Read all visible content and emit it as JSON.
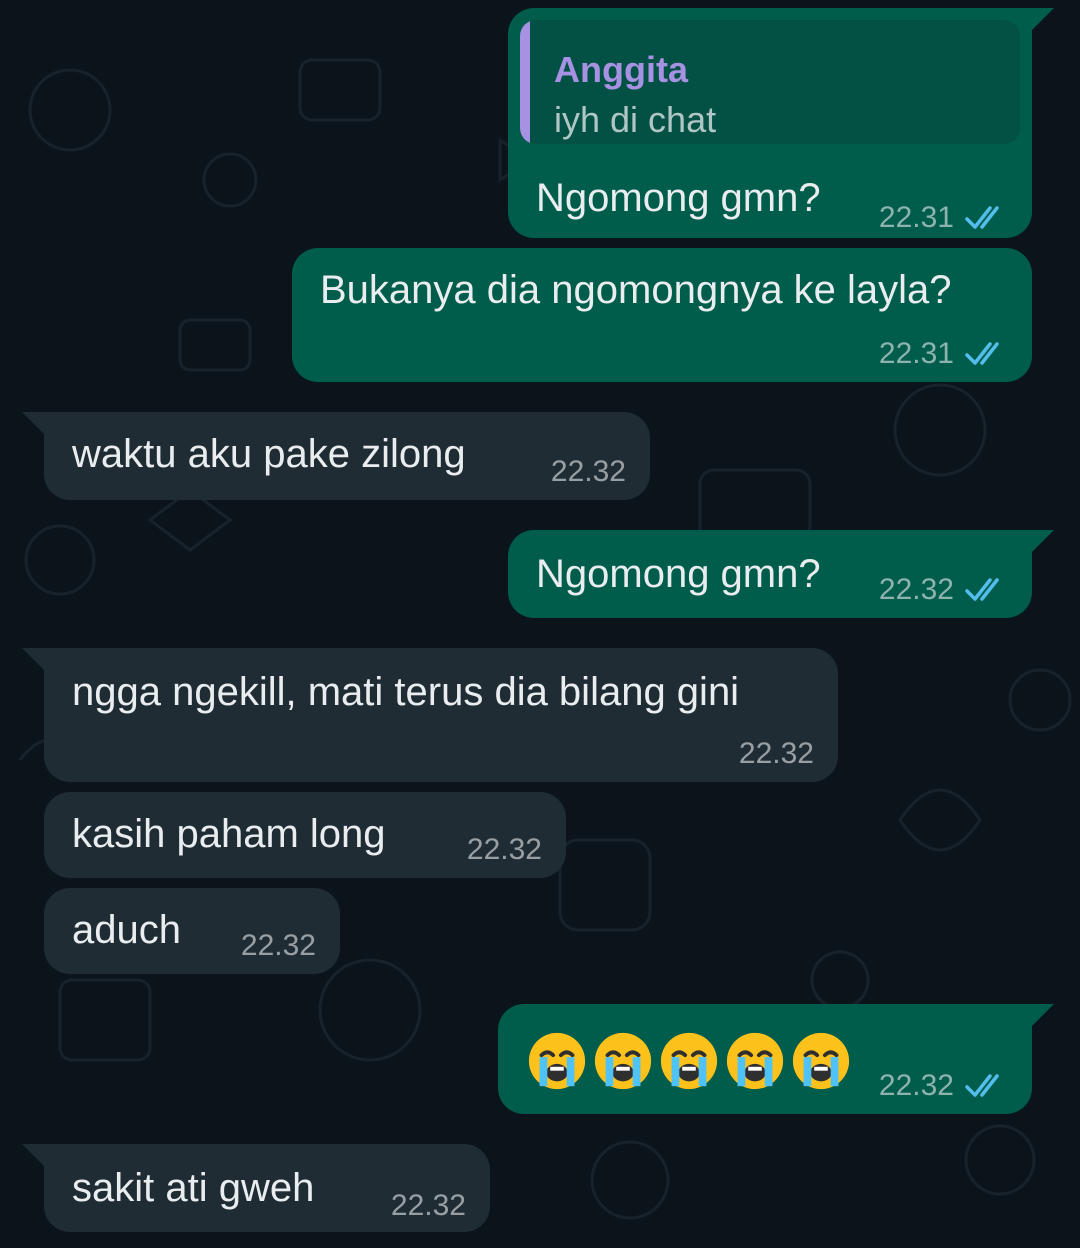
{
  "colors": {
    "background": "#0b141a",
    "outgoing_bubble": "#005c4b",
    "incoming_bubble": "#1f2c34",
    "read_ticks": "#53bdeb",
    "quote_accent": "#a791e2"
  },
  "messages": [
    {
      "direction": "out",
      "quote": {
        "author": "Anggita",
        "text": "iyh di chat"
      },
      "text": "Ngomong gmn?",
      "time": "22.31",
      "status_icon": "double-check-read-icon"
    },
    {
      "direction": "out",
      "text": "Bukanya dia ngomongnya ke layla?",
      "time": "22.31",
      "status_icon": "double-check-read-icon"
    },
    {
      "direction": "in",
      "text": "waktu aku pake zilong",
      "time": "22.32"
    },
    {
      "direction": "out",
      "text": "Ngomong gmn?",
      "time": "22.32",
      "status_icon": "double-check-read-icon"
    },
    {
      "direction": "in",
      "text": "ngga ngekill, mati terus dia bilang gini",
      "time": "22.32"
    },
    {
      "direction": "in",
      "text": "kasih paham long",
      "time": "22.32"
    },
    {
      "direction": "in",
      "text": "aduch",
      "time": "22.32"
    },
    {
      "direction": "out",
      "text": "😭😭😭😭😭",
      "emoji_icon": "loudly-crying-face-icon",
      "emoji_count": 5,
      "time": "22.32",
      "status_icon": "double-check-read-icon"
    },
    {
      "direction": "in",
      "text": "sakit ati gweh",
      "time": "22.32"
    }
  ]
}
